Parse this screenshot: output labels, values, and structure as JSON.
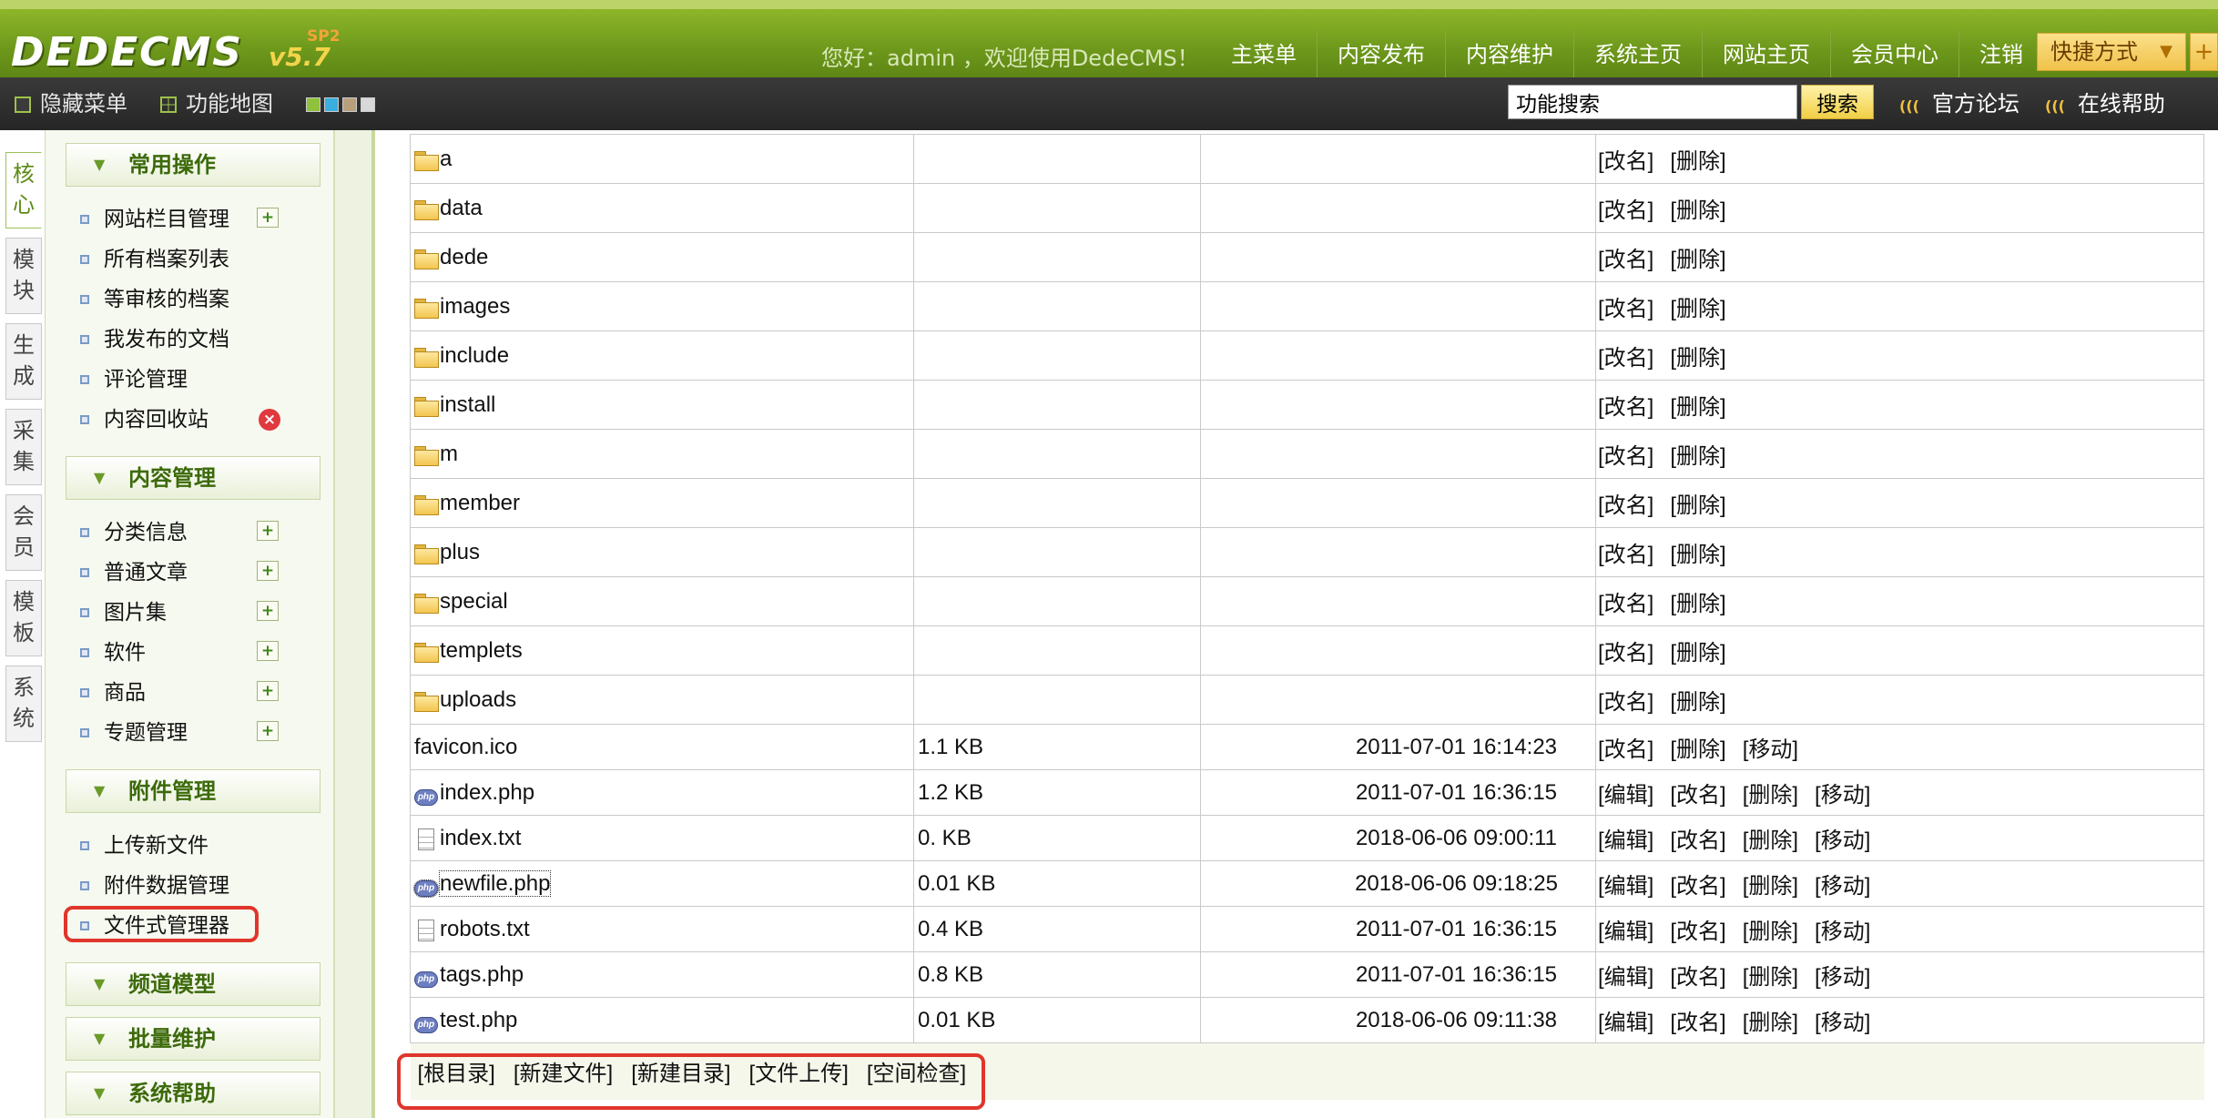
{
  "header": {
    "logo_text": "DEDECMS",
    "logo_version": "v5.7",
    "logo_sp": "SP2",
    "greeting": "您好：admin ，欢迎使用DedeCMS！",
    "nav": [
      "主菜单",
      "内容发布",
      "内容维护",
      "系统主页",
      "网站主页",
      "会员中心",
      "注销"
    ],
    "quick_label": "快捷方式",
    "quick_arrow": "▼",
    "quick_plus": "+"
  },
  "subbar": {
    "hide_menu": "隐藏菜单",
    "feature_map": "功能地图",
    "skin_colors": [
      "#8fc13a",
      "#3aaee0",
      "#b8a17a",
      "#d8d8d8"
    ],
    "search_value": "功能搜索",
    "search_button": "搜索",
    "forum_link": "官方论坛",
    "help_link": "在线帮助",
    "signal_icon": "signal-icon"
  },
  "left_tabs": [
    {
      "label": "核心",
      "chars": [
        "核",
        "心"
      ],
      "active": true
    },
    {
      "label": "模块",
      "chars": [
        "模",
        "块"
      ],
      "active": false
    },
    {
      "label": "生成",
      "chars": [
        "生",
        "成"
      ],
      "active": false
    },
    {
      "label": "采集",
      "chars": [
        "采",
        "集"
      ],
      "active": false
    },
    {
      "label": "会员",
      "chars": [
        "会",
        "员"
      ],
      "active": false
    },
    {
      "label": "模板",
      "chars": [
        "模",
        "板"
      ],
      "active": false
    },
    {
      "label": "系统",
      "chars": [
        "系",
        "统"
      ],
      "active": false
    }
  ],
  "menu": {
    "groups": [
      {
        "title": "常用操作",
        "items": [
          {
            "label": "网站栏目管理",
            "icon": "add-icon"
          },
          {
            "label": "所有档案列表",
            "icon": ""
          },
          {
            "label": "等审核的档案",
            "icon": ""
          },
          {
            "label": "我发布的文档",
            "icon": ""
          },
          {
            "label": "评论管理",
            "icon": ""
          },
          {
            "label": "内容回收站",
            "icon": "delete-icon"
          }
        ]
      },
      {
        "title": "内容管理",
        "items": [
          {
            "label": "分类信息",
            "icon": "add-icon"
          },
          {
            "label": "普通文章",
            "icon": "add-icon"
          },
          {
            "label": "图片集",
            "icon": "add-icon"
          },
          {
            "label": "软件",
            "icon": "add-icon"
          },
          {
            "label": "商品",
            "icon": "add-icon"
          },
          {
            "label": "专题管理",
            "icon": "add-icon"
          }
        ]
      },
      {
        "title": "附件管理",
        "items": [
          {
            "label": "上传新文件",
            "icon": ""
          },
          {
            "label": "附件数据管理",
            "icon": ""
          },
          {
            "label": "文件式管理器",
            "icon": ""
          }
        ]
      },
      {
        "title": "频道模型",
        "items": []
      },
      {
        "title": "批量维护",
        "items": []
      },
      {
        "title": "系统帮助",
        "items": []
      }
    ],
    "highlight_color": "#e0352b",
    "collapse_glyph": "▼"
  },
  "files": {
    "folder_actions": [
      "[改名]",
      "[删除]"
    ],
    "folders": [
      "a",
      "data",
      "dede",
      "images",
      "include",
      "install",
      "m",
      "member",
      "plus",
      "special",
      "templets",
      "uploads"
    ],
    "rows": [
      {
        "name": "favicon.ico",
        "icon": "none",
        "size": "1.1 KB",
        "time": "2011-07-01 16:14:23",
        "actions": [
          "[改名]",
          "[删除]",
          "[移动]"
        ]
      },
      {
        "name": "index.php",
        "icon": "php",
        "size": "1.2 KB",
        "time": "2011-07-01 16:36:15",
        "actions": [
          "[编辑]",
          "[改名]",
          "[删除]",
          "[移动]"
        ]
      },
      {
        "name": "index.txt",
        "icon": "txt",
        "size": "0. KB",
        "time": "2018-06-06 09:00:11",
        "actions": [
          "[编辑]",
          "[改名]",
          "[删除]",
          "[移动]"
        ]
      },
      {
        "name": "newfile.php",
        "icon": "php",
        "size": "0.01 KB",
        "time": "2018-06-06 09:18:25",
        "actions": [
          "[编辑]",
          "[改名]",
          "[删除]",
          "[移动]"
        ]
      },
      {
        "name": "robots.txt",
        "icon": "txt",
        "size": "0.4 KB",
        "time": "2011-07-01 16:36:15",
        "actions": [
          "[编辑]",
          "[改名]",
          "[删除]",
          "[移动]"
        ]
      },
      {
        "name": "tags.php",
        "icon": "php",
        "size": "0.8 KB",
        "time": "2011-07-01 16:36:15",
        "actions": [
          "[编辑]",
          "[改名]",
          "[删除]",
          "[移动]"
        ]
      },
      {
        "name": "test.php",
        "icon": "php",
        "size": "0.01 KB",
        "time": "2018-06-06 09:11:38",
        "actions": [
          "[编辑]",
          "[改名]",
          "[删除]",
          "[移动]"
        ]
      }
    ],
    "php_badge": "php",
    "bottom_links": [
      "[根目录]",
      "[新建文件]",
      "[新建目录]",
      "[文件上传]",
      "[空间检查]"
    ]
  }
}
